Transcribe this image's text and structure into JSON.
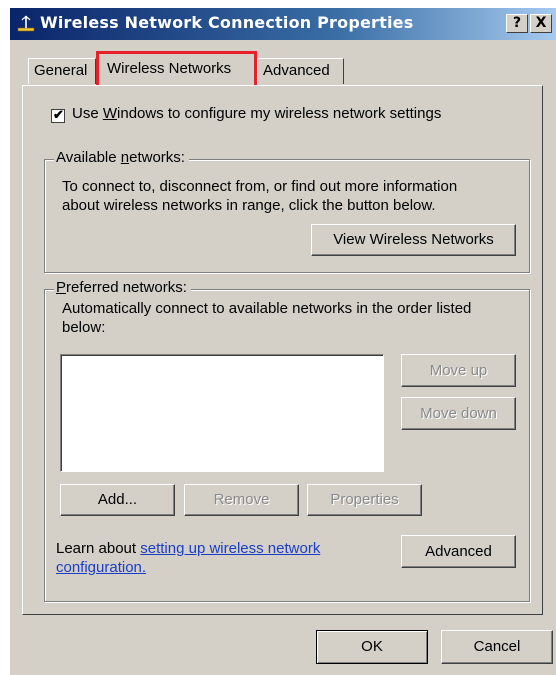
{
  "window": {
    "title": "Wireless Network Connection Properties",
    "help_button": "?",
    "close_button": "X"
  },
  "tabs": [
    {
      "label": "General",
      "active": false
    },
    {
      "label": "Wireless Networks",
      "active": true,
      "highlight_color": "#e8202a"
    },
    {
      "label": "Advanced",
      "active": false
    }
  ],
  "use_windows_checkbox": {
    "checked": true,
    "label": "Use Windows to configure my wireless network settings",
    "mnemonic": "W"
  },
  "available_networks": {
    "legend": "Available networks:",
    "mnemonic": "n",
    "description_line1": "To connect to, disconnect from, or find out more information",
    "description_line2": "about wireless networks in range, click the button below.",
    "view_button": "View Wireless Networks"
  },
  "preferred_networks": {
    "legend": "Preferred networks:",
    "mnemonic": "P",
    "description_line1": "Automatically connect to available networks in the order listed",
    "description_line2": "below:",
    "items": [],
    "move_up_button": "Move up",
    "move_down_button": "Move down",
    "add_button": "Add...",
    "remove_button": "Remove",
    "properties_button": "Properties",
    "learn_prefix": "Learn about ",
    "learn_link_line1": "setting up wireless network",
    "learn_link_line2": "configuration.",
    "advanced_button": "Advanced"
  },
  "footer": {
    "ok_button": "OK",
    "cancel_button": "Cancel"
  },
  "colors": {
    "titlebar_start": "#0a246a",
    "titlebar_end": "#a6caf0",
    "dialog_face": "#d4d0c8",
    "link": "#1a3dc8",
    "tab_highlight": "#e8202a"
  }
}
